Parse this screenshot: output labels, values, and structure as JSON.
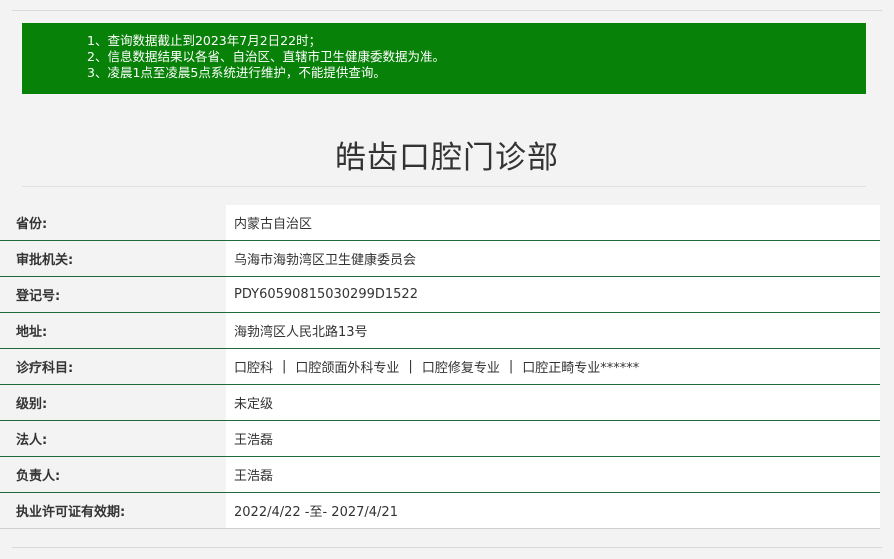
{
  "notice": {
    "lines": [
      "1、查询数据截止到2023年7月2日22时；",
      "2、信息数据结果以各省、自治区、直辖市卫生健康委数据为准。",
      "3、凌晨1点至凌晨5点系统进行维护，不能提供查询。"
    ],
    "background_color": "#088108"
  },
  "title": "皓齿口腔门诊部",
  "info": {
    "rows": [
      {
        "label": "省份:",
        "value": "内蒙古自治区"
      },
      {
        "label": "审批机关:",
        "value": "乌海市海勃湾区卫生健康委员会"
      },
      {
        "label": "登记号:",
        "value": "PDY60590815030299D1522"
      },
      {
        "label": "地址:",
        "value": "海勃湾区人民北路13号"
      },
      {
        "label": "诊疗科目:",
        "subjects": [
          "口腔科",
          "口腔颌面外科专业",
          "口腔修复专业",
          "口腔正畸专业******"
        ],
        "separator": "|"
      },
      {
        "label": "级别:",
        "value": "未定级"
      },
      {
        "label": "法人:",
        "value": "王浩磊"
      },
      {
        "label": "负责人:",
        "value": "王浩磊"
      },
      {
        "label": "执业许可证有效期:",
        "value": "2022/4/22 -至- 2027/4/21"
      }
    ]
  },
  "colors": {
    "row_divider": "#1f6b3b",
    "page_background": "#f3f3f3"
  }
}
